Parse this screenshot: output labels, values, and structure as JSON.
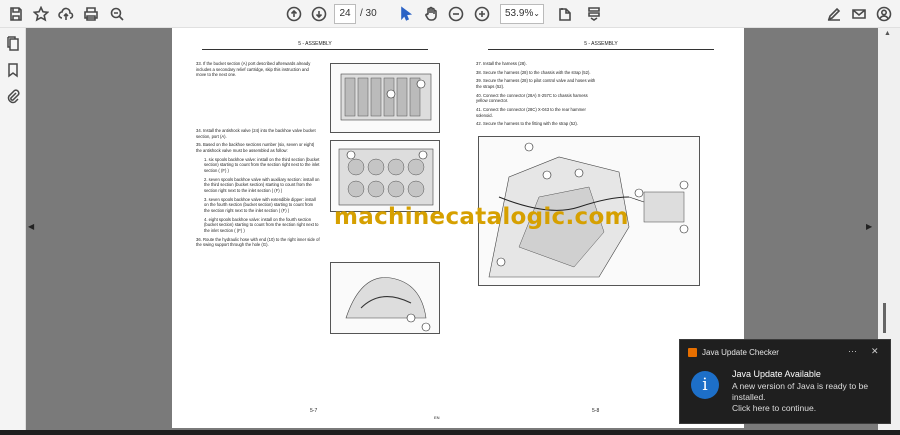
{
  "toolbar": {
    "page_current": "24",
    "page_total": "/ 30",
    "zoom": "53.9%"
  },
  "left_page": {
    "header": "5 - ASSEMBLY",
    "footer": "5-7",
    "corner": "EN",
    "steps": [
      "33. If the bucket section (A) port described afterwards already includes a secondary relief cartridge, skip this instruction and move to the next one.",
      "34. Install the antishock valve (24) into the backhoe valve bucket section, port (A).",
      "35. Based on the backhoe sections number (six, seven or eight) the antishock valve must be assembled as follow:",
      "1. six spools backhoe valve: install on the third section (bucket section) starting to count from the section right next to the inlet section ( (F) )",
      "2. seven spools backhoe valve with auxiliary section: install on the third section (bucket section) starting to count from the section right next to the inlet section ( (F) )",
      "3. seven spools backhoe valve with extendible dipper: install on the fourth section (bucket section) starting to count from the section right next to the inlet section ( (F) )",
      "4. eight spools backhoe valve: install on the fourth section (bucket section) starting to count from the section right next to the inlet section ( (F) )",
      "36. Route the hydraulic hose with end (10) to the right inner side of the swing support through the hole (G)."
    ]
  },
  "right_page": {
    "header": "5 - ASSEMBLY",
    "footer": "5-8",
    "steps": [
      "37. Install the harness (28).",
      "38. Secure the harness (28) to the chassis with the strap (52).",
      "39. Secure the harness (28) to pilot control valve and hoses with the straps (52).",
      "40. Connect the connector (28A) X-257C to chassis harness yellow connector.",
      "41. Connect the connector (28C) X-043 to the rear hammer solenoid.",
      "42. Secure the harness to the fitting with the strap (52)."
    ]
  },
  "watermark": "machinecatalogic.com",
  "notification": {
    "app": "Java Update Checker",
    "title": "Java Update Available",
    "message": "A new version of Java is ready to be installed.",
    "action": "Click here to continue.",
    "more": "···",
    "close": "✕"
  }
}
